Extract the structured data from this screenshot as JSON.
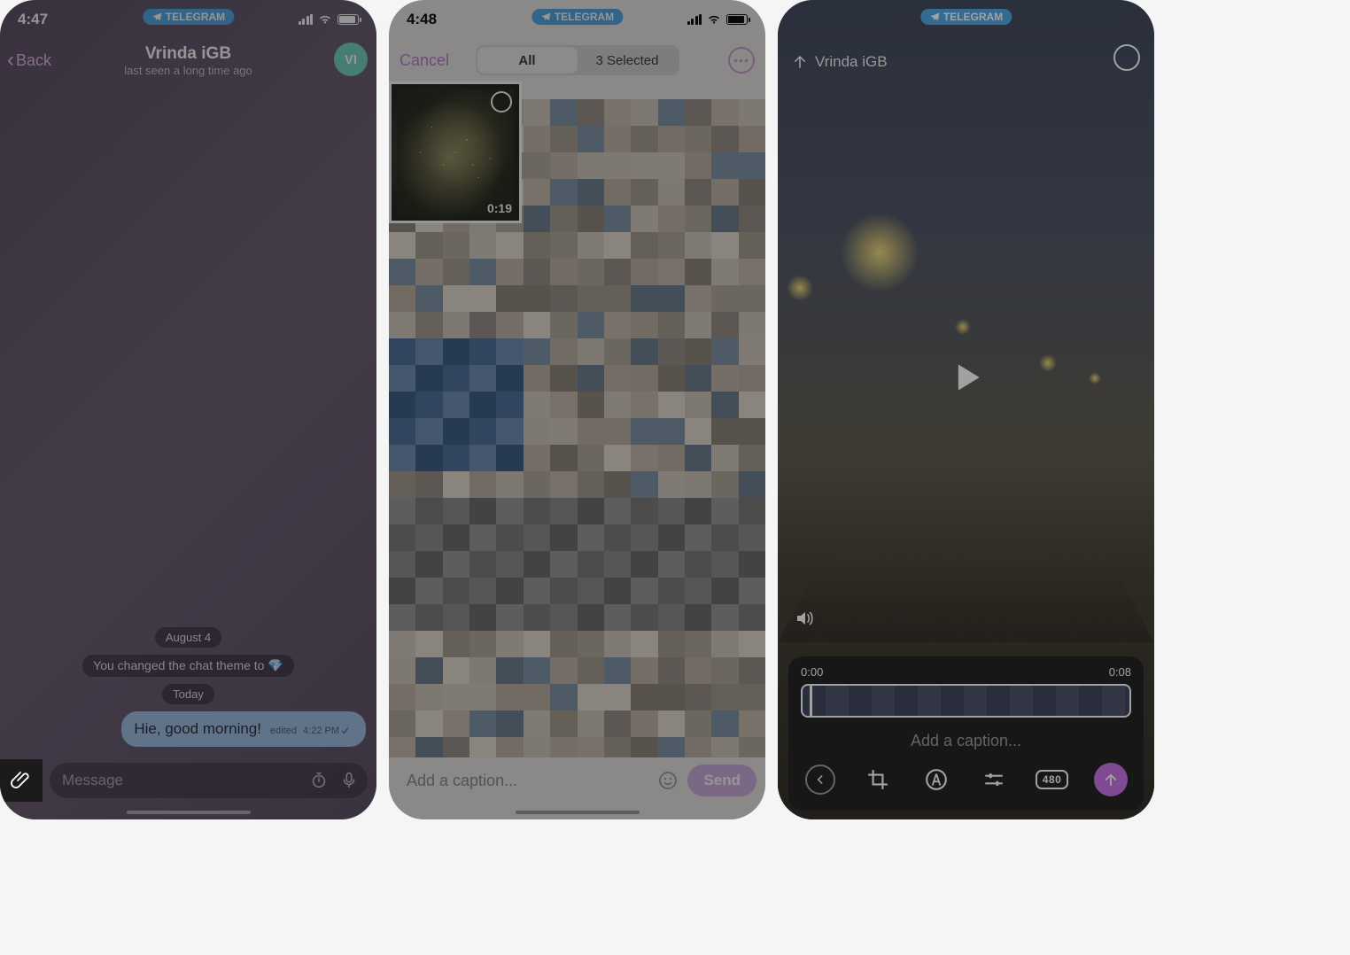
{
  "screen1": {
    "time": "4:47",
    "notification_app": "TELEGRAM",
    "back_label": "Back",
    "chat_title": "Vrinda iGB",
    "chat_subtitle": "last seen a long time ago",
    "avatar_initials": "VI",
    "date1": "August 4",
    "system_msg": "You changed the chat theme to",
    "theme_emoji": "💎",
    "date2": "Today",
    "message_text": "Hie, good morning!",
    "message_meta_edited": "edited",
    "message_meta_time": "4:22 PM",
    "input_placeholder": "Message"
  },
  "screen2": {
    "time": "4:48",
    "notification_app": "TELEGRAM",
    "cancel_label": "Cancel",
    "segment_all": "All",
    "segment_selected": "3 Selected",
    "video_duration": "0:19",
    "caption_placeholder": "Add a caption...",
    "send_label": "Send"
  },
  "screen3": {
    "notification_app": "TELEGRAM",
    "recipient": "Vrinda iGB",
    "trim_start": "0:00",
    "trim_end": "0:08",
    "caption_placeholder": "Add a caption...",
    "quality_label": "480"
  }
}
